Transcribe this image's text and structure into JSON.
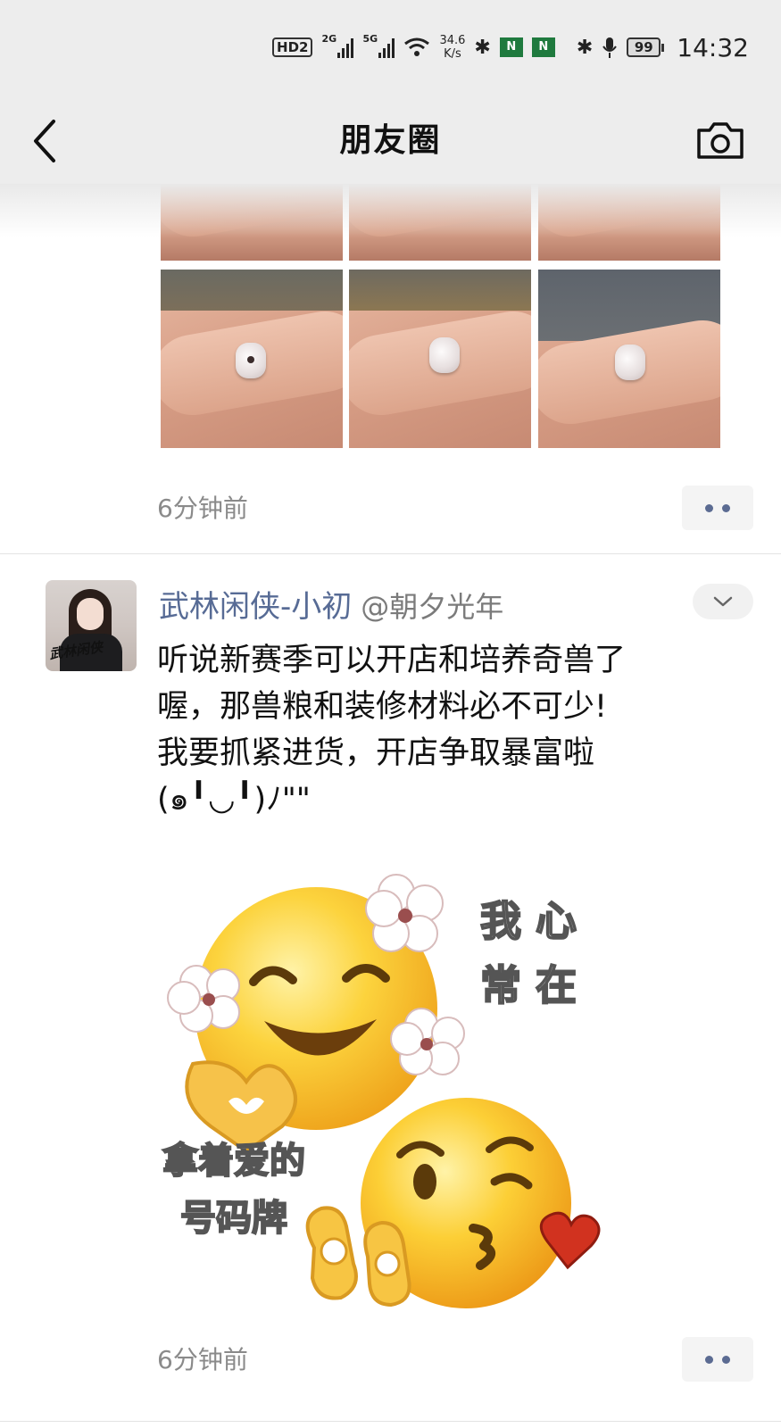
{
  "status_bar": {
    "hd_badge": "HD",
    "hd_badge2": "2",
    "sim1_label": "2G",
    "sim2_label": "5G",
    "speed_value": "34.6",
    "speed_unit": "K/s",
    "battery": "99",
    "time": "14:32",
    "icons": [
      "wifi-icon",
      "bluetooth-icon",
      "app-notification-icon",
      "app-notification-icon",
      "bluetooth-icon",
      "microphone-icon",
      "battery-icon"
    ]
  },
  "nav": {
    "title": "朋友圈",
    "back_icon": "back-arrow-icon",
    "camera_icon": "camera-icon"
  },
  "previous_post": {
    "time": "6分钟前",
    "photos_visible": 6
  },
  "post": {
    "author": "武林闲侠-小初",
    "handle": "@朝夕光年",
    "text_line1": "听说新赛季可以开店和培养奇兽了",
    "text_line2": "喔，那兽粮和装修材料必不可少!",
    "text_line3": "我要抓紧进货，开店争取暴富啦",
    "text_line4": "(๑╹◡╹)ﾉ\"\"",
    "avatar_caption": "武林闲侠",
    "meme_caption_right1": "我 心",
    "meme_caption_right2": "常 在",
    "meme_caption_left1": "拿着爱的",
    "meme_caption_left2": "号码牌",
    "time": "6分钟前"
  },
  "colors": {
    "bar_bg": "#ededed",
    "name_link": "#576b95",
    "time_gray": "#8a8a8a",
    "more_dots": "#5b6b92"
  }
}
